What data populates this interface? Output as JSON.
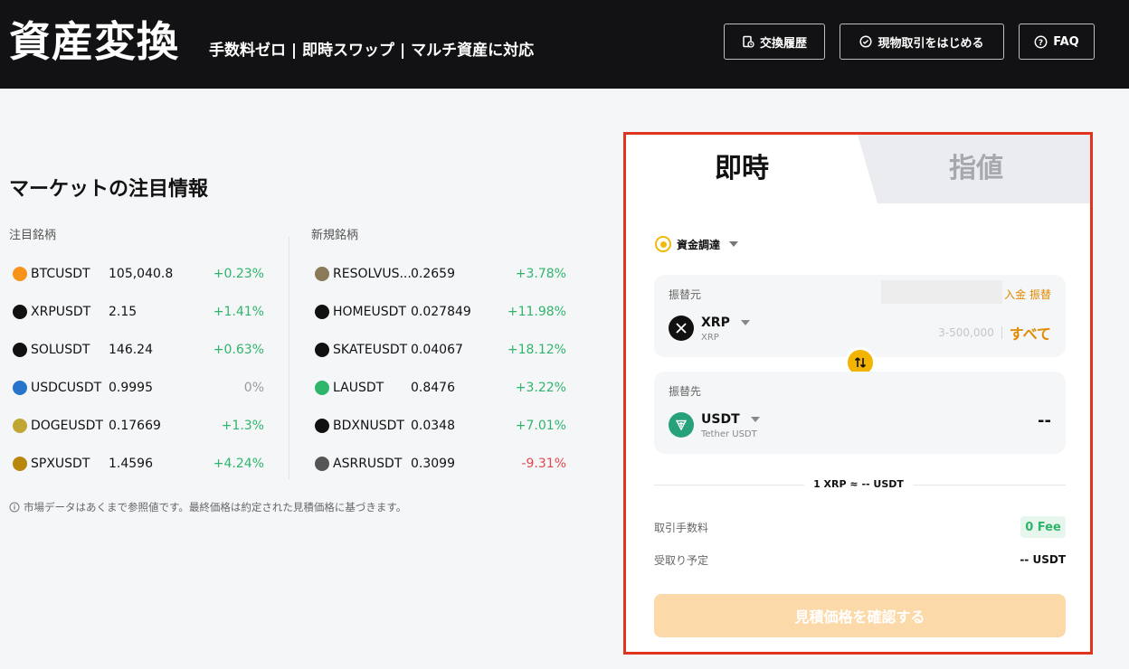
{
  "header": {
    "title": "資産変換",
    "subtitle": "手数料ゼロ | 即時スワップ | マルチ資産に対応",
    "buttons": [
      {
        "label": "交換履歴",
        "icon": "history-icon"
      },
      {
        "label": "現物取引をはじめる",
        "icon": "check-circle-icon"
      },
      {
        "label": "FAQ",
        "icon": "question-circle-icon"
      }
    ]
  },
  "market": {
    "title": "マーケットの注目情報",
    "col1_title": "注目銘柄",
    "col2_title": "新規銘柄",
    "col1": [
      {
        "symbol": "BTCUSDT",
        "price": "105,040.8",
        "change": "+0.23%",
        "dir": "up",
        "icon": "btc-icon",
        "color": "#f7931a"
      },
      {
        "symbol": "XRPUSDT",
        "price": "2.15",
        "change": "+1.41%",
        "dir": "up",
        "icon": "xrp-icon",
        "color": "#111111"
      },
      {
        "symbol": "SOLUSDT",
        "price": "146.24",
        "change": "+0.63%",
        "dir": "up",
        "icon": "sol-icon",
        "color": "#111111"
      },
      {
        "symbol": "USDCUSDT",
        "price": "0.9995",
        "change": "0%",
        "dir": "flat",
        "icon": "usdc-icon",
        "color": "#2775ca"
      },
      {
        "symbol": "DOGEUSDT",
        "price": "0.17669",
        "change": "+1.3%",
        "dir": "up",
        "icon": "doge-icon",
        "color": "#c2a633"
      },
      {
        "symbol": "SPXUSDT",
        "price": "1.4596",
        "change": "+4.24%",
        "dir": "up",
        "icon": "spx-icon",
        "color": "#b8860b"
      }
    ],
    "col2": [
      {
        "symbol": "RESOLVUS...",
        "price": "0.2659",
        "change": "+3.78%",
        "dir": "up",
        "icon": "resolv-icon",
        "color": "#8a7a5a"
      },
      {
        "symbol": "HOMEUSDT",
        "price": "0.027849",
        "change": "+11.98%",
        "dir": "up",
        "icon": "home-icon",
        "color": "#111111"
      },
      {
        "symbol": "SKATEUSDT",
        "price": "0.04067",
        "change": "+18.12%",
        "dir": "up",
        "icon": "skate-icon",
        "color": "#111111"
      },
      {
        "symbol": "LAUSDT",
        "price": "0.8476",
        "change": "+3.22%",
        "dir": "up",
        "icon": "la-icon",
        "color": "#2fb56b"
      },
      {
        "symbol": "BDXNUSDT",
        "price": "0.0348",
        "change": "+7.01%",
        "dir": "up",
        "icon": "bdxn-icon",
        "color": "#111111"
      },
      {
        "symbol": "ASRRUSDT",
        "price": "0.3099",
        "change": "-9.31%",
        "dir": "dn",
        "icon": "asrr-icon",
        "color": "#555555"
      }
    ],
    "note": "市場データはあくまで参照値です。最終価格は約定された見積価格に基づきます。"
  },
  "panel": {
    "tab_instant": "即時",
    "tab_limit": "指値",
    "funding": "資金調達",
    "from": {
      "label": "振替元",
      "deposit": "入金",
      "transfer": "振替",
      "token": "XRP",
      "token_sub": "XRP",
      "range": "3-500,000",
      "all": "すべて"
    },
    "to": {
      "label": "振替先",
      "token": "USDT",
      "token_sub": "Tether USDT",
      "amount": "--"
    },
    "rate": "1 XRP ≈ -- USDT",
    "fee_label": "取引手数料",
    "fee_value": "0 Fee",
    "receive_label": "受取り予定",
    "receive_value": "-- USDT",
    "confirm": "見積価格を確認する"
  },
  "colors": {
    "up": "#2fb56b",
    "down": "#e5484d",
    "accent": "#f3b400",
    "highlight_border": "#e0341f"
  }
}
